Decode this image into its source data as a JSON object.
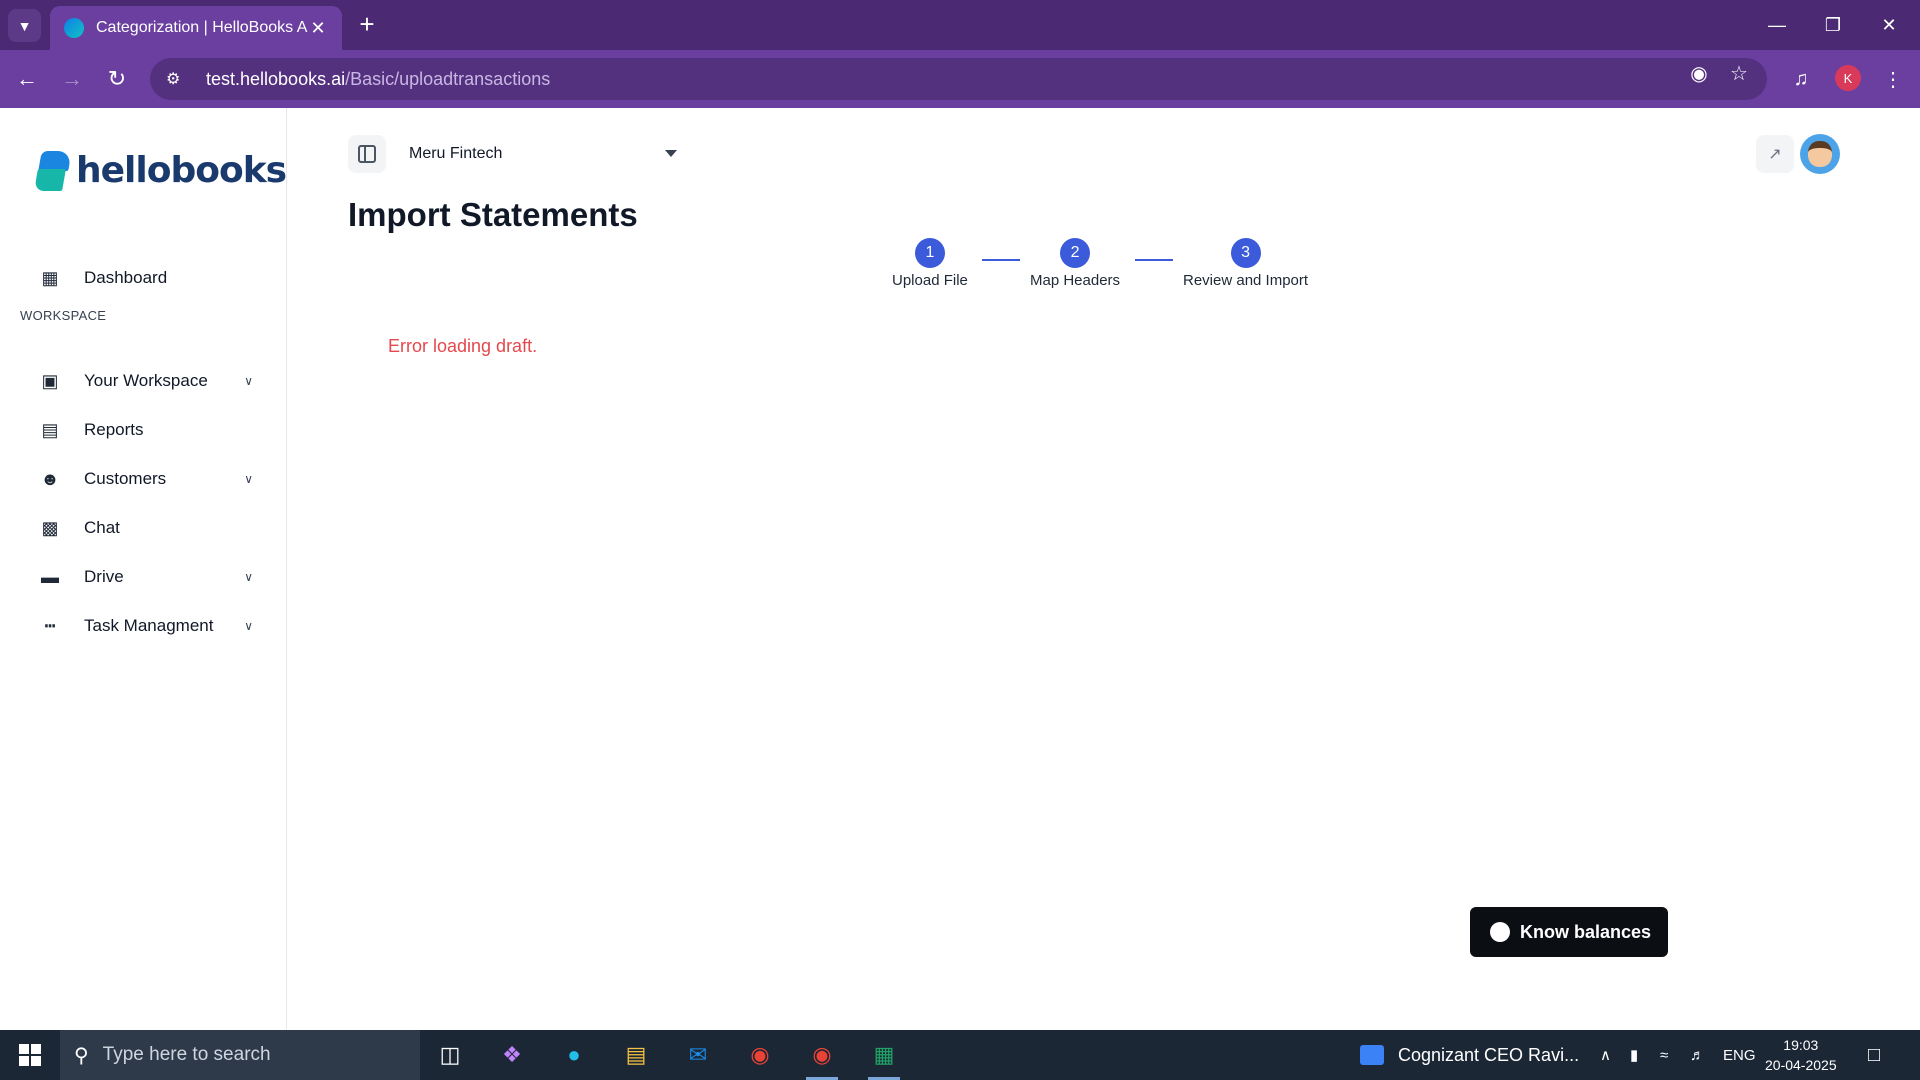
{
  "browser": {
    "tab_title": "Categorization | HelloBooks AI",
    "url_host": "test.hellobooks.ai",
    "url_path": "/Basic/uploadtransactions",
    "profile_initial": "K"
  },
  "sidebar": {
    "logo_text": "hellobooks",
    "dashboard": "Dashboard",
    "section_label": "WORKSPACE",
    "items": [
      {
        "label": "Your Workspace",
        "icon": "workspace-icon",
        "expandable": true
      },
      {
        "label": "Reports",
        "icon": "bar-chart-icon",
        "expandable": false
      },
      {
        "label": "Customers",
        "icon": "contact-card-icon",
        "expandable": true
      },
      {
        "label": "Chat",
        "icon": "chat-icon",
        "expandable": false
      },
      {
        "label": "Drive",
        "icon": "drive-icon",
        "expandable": true
      },
      {
        "label": "Task Managment",
        "icon": "task-icon",
        "expandable": true
      }
    ]
  },
  "header": {
    "company": "Meru Fintech"
  },
  "main": {
    "title": "Import Statements",
    "steps": [
      {
        "number": "1",
        "label": "Upload File"
      },
      {
        "number": "2",
        "label": "Map Headers"
      },
      {
        "number": "3",
        "label": "Review and Import"
      }
    ],
    "error": "Error loading draft.",
    "floating_button": "Know balances"
  },
  "taskbar": {
    "search_placeholder": "Type here to search",
    "news": "Cognizant CEO Ravi...",
    "language": "ENG",
    "time": "19:03",
    "date": "20-04-2025"
  },
  "colors": {
    "tabbar": "#4b2a73",
    "toolbar": "#6b3fa0",
    "step_accent": "#3b5bdb",
    "error": "#e5484d"
  }
}
